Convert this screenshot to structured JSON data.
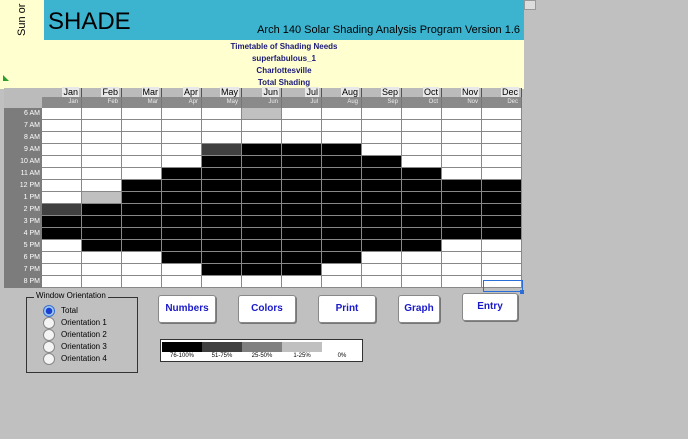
{
  "app": {
    "side_label": "Sun or",
    "title": "SHADE",
    "subtitle": "Arch 140 Solar Shading Analysis Program Version 1.6"
  },
  "info": {
    "line1": "Timetable of Shading Needs",
    "line2": "superfabulous_1",
    "line3": "Charlottesville",
    "line4": "Total Shading"
  },
  "months": [
    "Jan",
    "Feb",
    "Mar",
    "Apr",
    "May",
    "Jun",
    "Jul",
    "Aug",
    "Sep",
    "Oct",
    "Nov",
    "Dec"
  ],
  "hours": [
    "6 AM",
    "7 AM",
    "8 AM",
    "9 AM",
    "10 AM",
    "11 AM",
    "12 PM",
    "1 PM",
    "2 PM",
    "3 PM",
    "4 PM",
    "5 PM",
    "6 PM",
    "7 PM",
    "8 PM"
  ],
  "shading_levels": [
    [
      0,
      0,
      0,
      0,
      0,
      1,
      0,
      0,
      0,
      0,
      0,
      0
    ],
    [
      0,
      0,
      0,
      0,
      0,
      0,
      0,
      0,
      0,
      0,
      0,
      0
    ],
    [
      0,
      0,
      0,
      0,
      0,
      0,
      0,
      0,
      0,
      0,
      0,
      0
    ],
    [
      0,
      0,
      0,
      0,
      3,
      4,
      4,
      4,
      0,
      0,
      0,
      0
    ],
    [
      0,
      0,
      0,
      0,
      4,
      4,
      4,
      4,
      4,
      0,
      0,
      0
    ],
    [
      0,
      0,
      0,
      4,
      4,
      4,
      4,
      4,
      4,
      4,
      0,
      0
    ],
    [
      0,
      0,
      4,
      4,
      4,
      4,
      4,
      4,
      4,
      4,
      4,
      4
    ],
    [
      0,
      1,
      4,
      4,
      4,
      4,
      4,
      4,
      4,
      4,
      4,
      4
    ],
    [
      3,
      4,
      4,
      4,
      4,
      4,
      4,
      4,
      4,
      4,
      4,
      4
    ],
    [
      4,
      4,
      4,
      4,
      4,
      4,
      4,
      4,
      4,
      4,
      4,
      4
    ],
    [
      4,
      4,
      4,
      4,
      4,
      4,
      4,
      4,
      4,
      4,
      4,
      4
    ],
    [
      0,
      4,
      4,
      4,
      4,
      4,
      4,
      4,
      4,
      4,
      0,
      0
    ],
    [
      0,
      0,
      0,
      4,
      4,
      4,
      4,
      4,
      0,
      0,
      0,
      0
    ],
    [
      0,
      0,
      0,
      0,
      4,
      4,
      4,
      0,
      0,
      0,
      0,
      0
    ],
    [
      0,
      0,
      0,
      0,
      0,
      0,
      0,
      0,
      0,
      0,
      0,
      0
    ]
  ],
  "orientation": {
    "title": "Window Orientation",
    "options": [
      "Total",
      "Orientation 1",
      "Orientation 2",
      "Orientation 3",
      "Orientation 4"
    ],
    "selected": "Total"
  },
  "buttons": {
    "numbers": "Numbers",
    "colors": "Colors",
    "print": "Print",
    "graph": "Graph",
    "entry": "Entry"
  },
  "legend": [
    {
      "label": "76-100%",
      "color": "#000000"
    },
    {
      "label": "51-75%",
      "color": "#404040"
    },
    {
      "label": "25-50%",
      "color": "#808080"
    },
    {
      "label": "1-25%",
      "color": "#c0c0c0"
    },
    {
      "label": "0%",
      "color": "#ffffff"
    }
  ],
  "colors": {
    "title_bar": "#3cb4d0",
    "info_panel": "#ffffd0",
    "button_text": "#1a1ac8",
    "info_text": "#1a1a7a"
  }
}
